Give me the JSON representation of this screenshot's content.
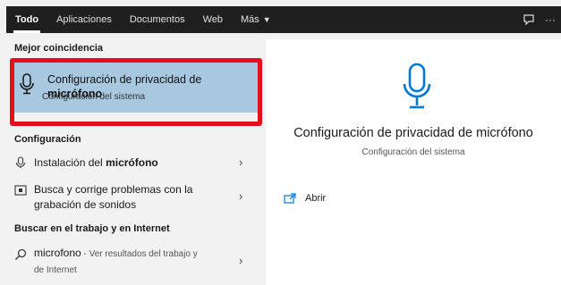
{
  "topbar": {
    "tabs": [
      {
        "label": "Todo"
      },
      {
        "label": "Aplicaciones"
      },
      {
        "label": "Documentos"
      },
      {
        "label": "Web"
      },
      {
        "label": "Más"
      }
    ],
    "icons": [
      "feedback-icon",
      "more-options-icon"
    ],
    "more_glyph": "···"
  },
  "best_match": {
    "header": "Mejor coincidencia",
    "title_line1": "Configuración de privacidad de",
    "title_line2": "micrófono",
    "subtitle": "Configuración del sistema",
    "icon": "microphone-icon"
  },
  "config_section": {
    "header": "Configuración",
    "items": [
      {
        "pre": "Instalación del ",
        "bold": "micrófono",
        "icon": "microphone-icon"
      },
      {
        "line1": "Busca y corrige problemas con la",
        "line2": "grabación de sonidos",
        "icon": "troubleshoot-icon"
      }
    ]
  },
  "web_section": {
    "header": "Buscar en el trabajo y en Internet",
    "item": {
      "query": "microfono",
      "hint_line1": " - Ver resultados del trabajo y",
      "hint_line2": "de Internet",
      "icon": "search-icon"
    }
  },
  "preview": {
    "title": "Configuración de privacidad de micrófono",
    "subtitle": "Configuración del sistema",
    "action_label": "Abrir",
    "icon": "microphone-icon",
    "accent": "#0078d4"
  },
  "colors": {
    "highlight": "#a8c8e0",
    "focus_frame": "#e3101a",
    "topbar": "#1f1f1f"
  }
}
